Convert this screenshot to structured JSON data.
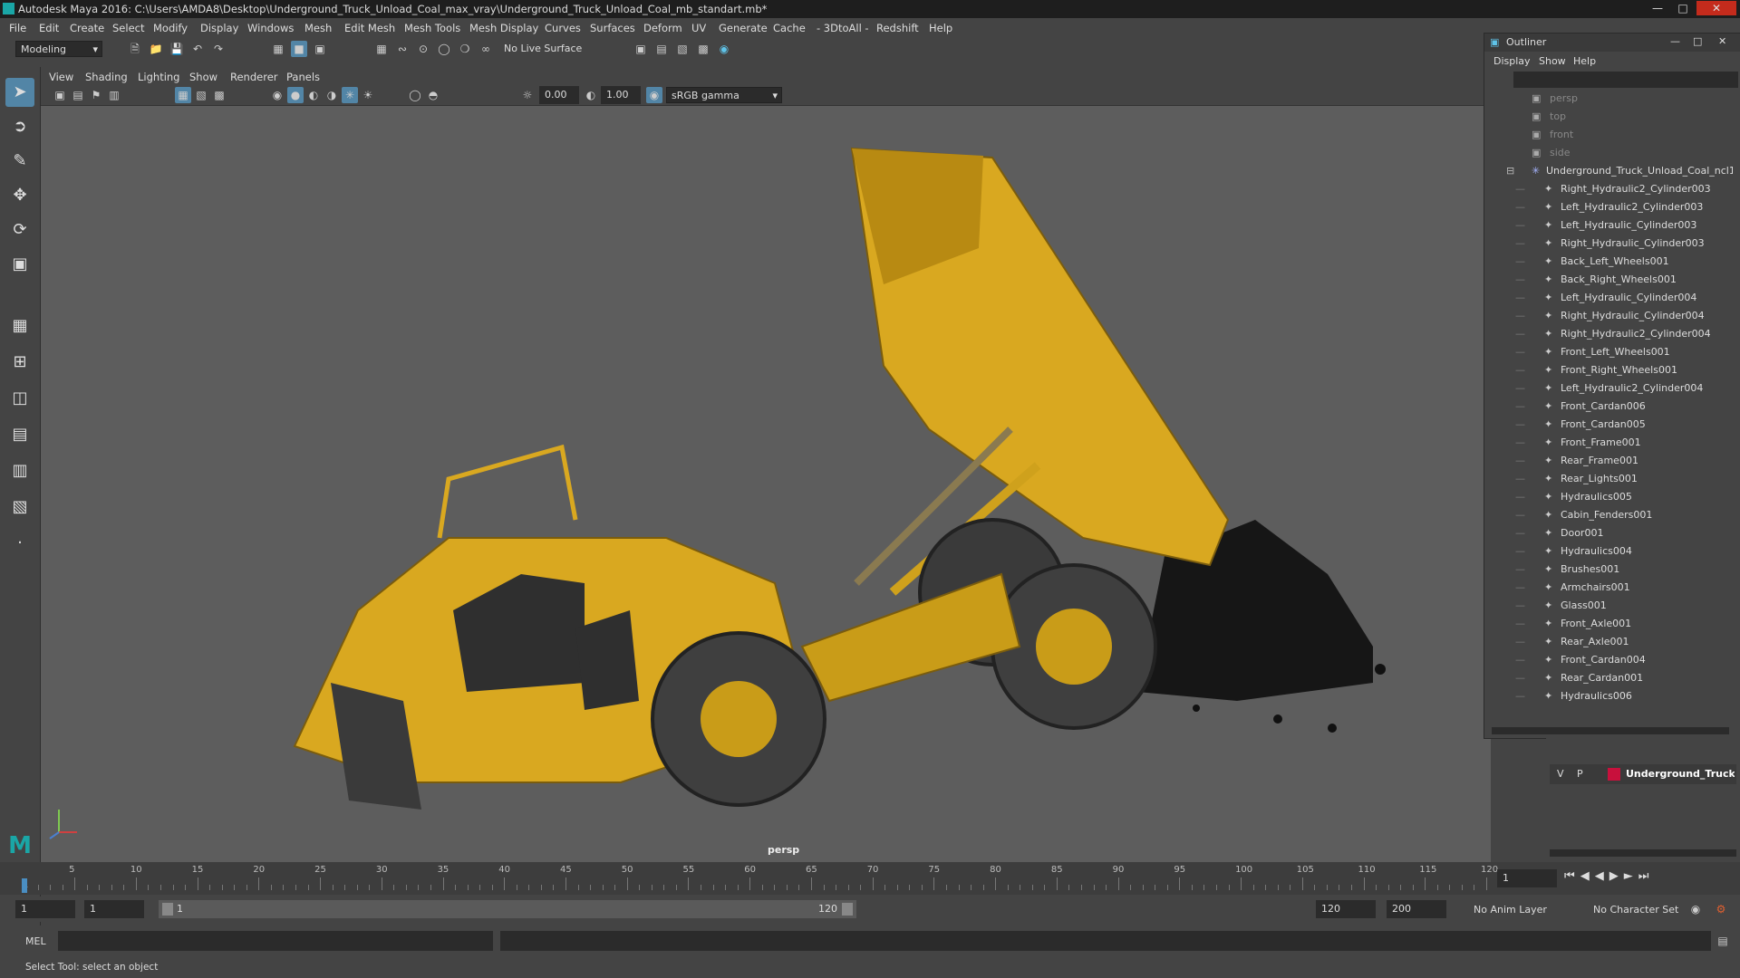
{
  "window": {
    "title": "Autodesk Maya 2016: C:\\Users\\AMDA8\\Desktop\\Underground_Truck_Unload_Coal_max_vray\\Underground_Truck_Unload_Coal_mb_standart.mb*"
  },
  "menus": [
    "File",
    "Edit",
    "Create",
    "Select",
    "Modify",
    "Display",
    "Windows",
    "Mesh",
    "Edit Mesh",
    "Mesh Tools",
    "Mesh Display",
    "Curves",
    "Surfaces",
    "Deform",
    "UV",
    "Generate",
    "Cache",
    "- 3DtoAll -",
    "Redshift",
    "Help"
  ],
  "status": {
    "mode": "Modeling",
    "live_surface": "No Live Surface"
  },
  "viewport": {
    "menus": [
      "View",
      "Shading",
      "Lighting",
      "Show",
      "Renderer",
      "Panels"
    ],
    "field1": "0.00",
    "field2": "1.00",
    "color_space": "sRGB gamma",
    "camera_label": "persp"
  },
  "outliner": {
    "title": "Outliner",
    "menus": [
      "Display",
      "Show",
      "Help"
    ],
    "cameras": [
      "persp",
      "top",
      "front",
      "side"
    ],
    "root": "Underground_Truck_Unload_Coal_ncl1_",
    "items": [
      "Right_Hydraulic2_Cylinder003",
      "Left_Hydraulic2_Cylinder003",
      "Left_Hydraulic_Cylinder003",
      "Right_Hydraulic_Cylinder003",
      "Back_Left_Wheels001",
      "Back_Right_Wheels001",
      "Left_Hydraulic_Cylinder004",
      "Right_Hydraulic_Cylinder004",
      "Right_Hydraulic2_Cylinder004",
      "Front_Left_Wheels001",
      "Front_Right_Wheels001",
      "Left_Hydraulic2_Cylinder004",
      "Front_Cardan006",
      "Front_Cardan005",
      "Front_Frame001",
      "Rear_Frame001",
      "Rear_Lights001",
      "Hydraulics005",
      "Cabin_Fenders001",
      "Door001",
      "Hydraulics004",
      "Brushes001",
      "Armchairs001",
      "Glass001",
      "Front_Axle001",
      "Rear_Axle001",
      "Front_Cardan004",
      "Rear_Cardan001",
      "Hydraulics006"
    ]
  },
  "layers": {
    "v": "V",
    "p": "P",
    "name": "Underground_Truck_U",
    "color": "#c8103c"
  },
  "timeline": {
    "ticks": [
      "5",
      "10",
      "15",
      "20",
      "25",
      "30",
      "35",
      "40",
      "45",
      "50",
      "55",
      "60",
      "65",
      "70",
      "75",
      "80",
      "85",
      "90",
      "95",
      "100",
      "105",
      "110",
      "115",
      "120"
    ],
    "start_label": "1",
    "current_frame": "1"
  },
  "range": {
    "start": "1",
    "playback_start": "1",
    "slider_start": "1",
    "slider_end": "120",
    "playback_end": "120",
    "end": "200",
    "anim_layer": "No Anim Layer",
    "char_set": "No Character Set"
  },
  "cmd": {
    "label": "MEL"
  },
  "help": {
    "text": "Select Tool: select an object"
  },
  "colors": {
    "truck_yellow": "#d9a820",
    "viewport_bg": "#5d5d5d"
  }
}
